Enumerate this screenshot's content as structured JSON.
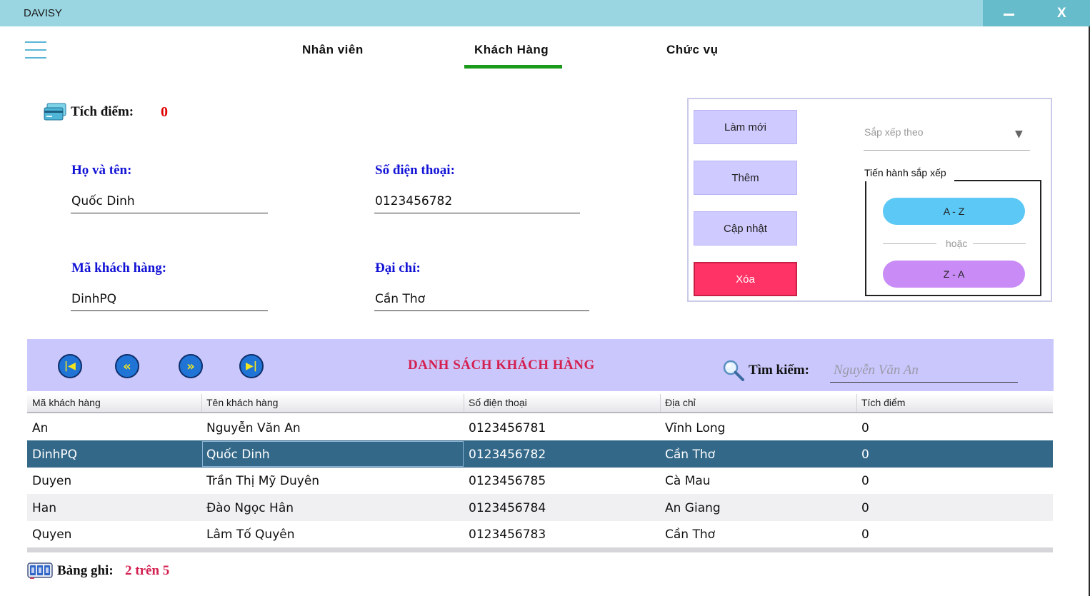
{
  "window": {
    "title": "DAVISY",
    "minimize_symbol": "",
    "close_symbol": "X"
  },
  "tabs": [
    {
      "label": "Nhân viên"
    },
    {
      "label": "Khách Hàng",
      "active": true
    },
    {
      "label": "Chức vụ"
    }
  ],
  "info": {
    "points_label": "Tích điểm:",
    "points_value": "0",
    "name_label": "Họ và tên:",
    "name_value": "Quốc Dinh",
    "phone_label": "Số điện thoại:",
    "phone_value": "0123456782",
    "code_label": "Mã khách hàng:",
    "code_value": "DinhPQ",
    "address_label": "Đại chỉ:",
    "address_value": "Cần Thơ"
  },
  "actions": {
    "refresh": "Làm mới",
    "add": "Thêm",
    "update": "Cập nhật",
    "delete": "Xóa",
    "sort_placeholder": "Sắp xếp theo",
    "sort_section_label": "Tiến hành sắp xếp",
    "sort_az": "A - Z",
    "or_label": "hoặc",
    "sort_za": "Z - A"
  },
  "list": {
    "title": "DANH SÁCH KHÁCH HÀNG",
    "search_label": "Tìm kiếm:",
    "search_placeholder": "Nguyễn Văn An",
    "nav": {
      "first": "|◀",
      "prev": "«",
      "next": "»",
      "last": "▶|"
    },
    "columns": [
      "Mã khách hàng",
      "Tên khách hàng",
      "Số điện thoại",
      "Địa chỉ",
      "Tích điểm"
    ],
    "rows": [
      [
        "An",
        "Nguyễn Văn An",
        "0123456781",
        "Vĩnh Long",
        "0"
      ],
      [
        "DinhPQ",
        "Quốc Dinh",
        "0123456782",
        "Cần Thơ",
        "0"
      ],
      [
        "Duyen",
        "Trần Thị Mỹ Duyên",
        "0123456785",
        "Cà Mau",
        "0"
      ],
      [
        "Han",
        "Đào Ngọc Hân",
        "0123456784",
        "An Giang",
        "0"
      ],
      [
        "Quyen",
        "Lâm Tố Quyên",
        "0123456783",
        "Cần Thơ",
        "0"
      ]
    ],
    "selected_row": 1
  },
  "footer": {
    "records_label": "Bảng ghi:",
    "records_value": "2 trên 5"
  },
  "colors": {
    "titlebar": "#9ad6e1",
    "tab_active_underline": "#1c9a1c",
    "label_blue": "#1313d6",
    "accent_red": "#e00000",
    "delete_button": "#ff3366",
    "list_header_bg": "#c9c7fb",
    "selected_row": "#336889",
    "sort_az": "#5cc8f5",
    "sort_za": "#c98cf7"
  },
  "icons": {
    "menu": "hamburger-icon",
    "points": "credit-card-icon",
    "search": "magnifier-icon",
    "records": "counter-icon"
  }
}
